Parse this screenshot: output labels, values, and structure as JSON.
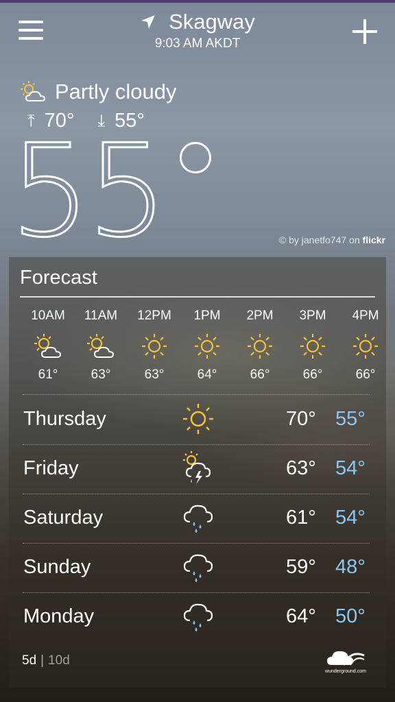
{
  "header": {
    "city": "Skagway",
    "time": "9:03 AM AKDT"
  },
  "current": {
    "condition": "Partly cloudy",
    "high": "70°",
    "low": "55°",
    "temp": "55",
    "high_arrow": "⤒",
    "low_arrow": "⤓"
  },
  "credit": {
    "prefix": "© by janetfo747 on",
    "brand": "flickr"
  },
  "forecast": {
    "title": "Forecast",
    "hourly": [
      {
        "time": "10AM",
        "temp": "61°",
        "icon": "partly-cloudy-icon"
      },
      {
        "time": "11AM",
        "temp": "63°",
        "icon": "partly-cloudy-icon"
      },
      {
        "time": "12PM",
        "temp": "63°",
        "icon": "sun-icon"
      },
      {
        "time": "1PM",
        "temp": "64°",
        "icon": "sun-icon"
      },
      {
        "time": "2PM",
        "temp": "66°",
        "icon": "sun-icon"
      },
      {
        "time": "3PM",
        "temp": "66°",
        "icon": "sun-icon"
      },
      {
        "time": "4PM",
        "temp": "66°",
        "icon": "sun-icon"
      }
    ],
    "daily": [
      {
        "day": "Thursday",
        "high": "70°",
        "low": "55°",
        "icon": "sun-icon"
      },
      {
        "day": "Friday",
        "high": "63°",
        "low": "54°",
        "icon": "thunderstorm-icon"
      },
      {
        "day": "Saturday",
        "high": "61°",
        "low": "54°",
        "icon": "rain-icon"
      },
      {
        "day": "Sunday",
        "high": "59°",
        "low": "48°",
        "icon": "rain-icon"
      },
      {
        "day": "Monday",
        "high": "64°",
        "low": "50°",
        "icon": "rain-icon"
      }
    ],
    "tabs": {
      "five": "5d",
      "ten": "10d"
    },
    "logo": "wunderground.com"
  },
  "colors": {
    "low_temp": "#8ec6f2",
    "sun": "#f3c23a",
    "rain": "#7fc0ef"
  }
}
